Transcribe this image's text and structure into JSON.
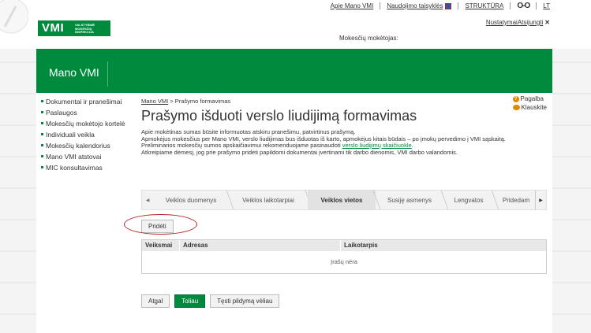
{
  "header": {
    "logo_big": "VMI",
    "logo_small": [
      "VALSTYBINĖ",
      "MOKESČIŲ",
      "INSPEKCIJA"
    ],
    "links": [
      "Apie Mano VMI",
      "Naudojimo taisyklės",
      "STRUKTŪRA",
      "LT"
    ],
    "glasses_icon": "glasses-icon",
    "links2": [
      "Nustatymai",
      "Atsijungti"
    ],
    "taxpayer_label": "Mokesčių mokėtojas:"
  },
  "banner": {
    "title": "Mano VMI"
  },
  "sidebar": {
    "items": [
      {
        "label": "Dokumentai ir pranešimai"
      },
      {
        "label": "Paslaugos"
      },
      {
        "label": "Mokesčių mokėtojo kortelė"
      },
      {
        "label": "Individuali veikla"
      },
      {
        "label": "Mokesčių kalendorius"
      },
      {
        "label": "Mano VMI atstovai"
      },
      {
        "label": "MIC konsultavimas"
      }
    ]
  },
  "content": {
    "breadcrumb_link": "Mano VMI",
    "breadcrumb_current": "> Prašymo formavimas",
    "title": "Prašymo išduoti verslo liudijimą formavimas",
    "help": "Pagalba",
    "ask": "Klauskite",
    "desc1": "Apie mokėtinas sumas būsite informuotas atskiru pranešimu, patvirtinus prašymą.",
    "desc2": "Apmokėjus mokesčius per Mano VMI, verslo liudijimas bus išduotas iš karto, apmokėjus kitais būdais – po įmokų pervedimo į VMI sąskaitą.",
    "desc3_pre": "Preliminarios mokesčių sumos apskaičiavimui rekomenduojame pasinaudoti",
    "desc3_link": "verslo liudijimų skaičiuokle",
    "desc3_post": ".",
    "desc4": "Atkreipiame dėmesį, jog prie prašymo pridėti papildomi dokumentai įvertinami tik darbo dienomis, VMI darbo valandomis."
  },
  "wizard": {
    "steps": [
      "Veiklos duomenys",
      "Veiklos laikotarpiai",
      "Veiklos vietos",
      "Susiję asmenys",
      "Lengvatos",
      "Pridedam"
    ],
    "active": "Veiklos vietos"
  },
  "add_button": "Pridėti",
  "table": {
    "columns": [
      "Veiksmai",
      "Adresas",
      "Laikotarpis"
    ],
    "empty": "Įrašų nėra"
  },
  "actions": {
    "back": "Atgal",
    "next": "Toliau",
    "later": "Tęsti pildymą vėliau"
  },
  "colors": {
    "brand": "#008a3e",
    "accent": "#e08a00",
    "highlight": "#b3262a"
  }
}
